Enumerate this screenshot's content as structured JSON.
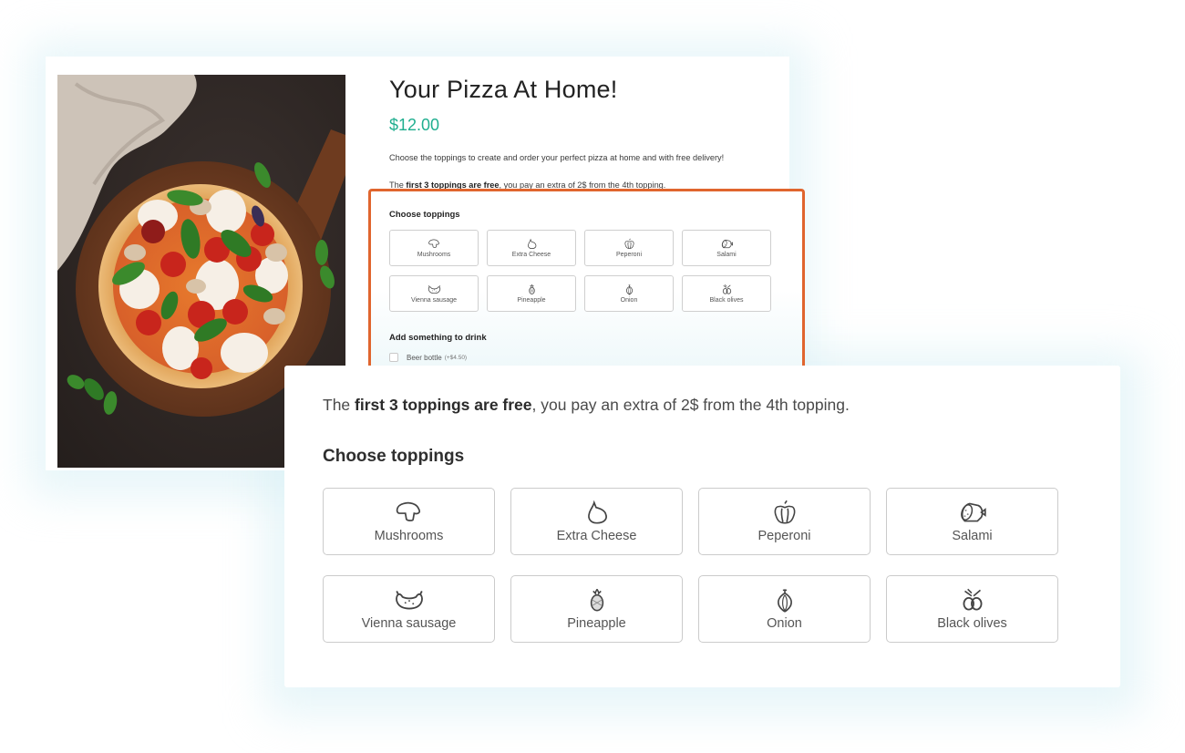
{
  "product": {
    "title": "Your Pizza At Home!",
    "price": "$12.00",
    "description": "Choose the toppings to create and order your perfect pizza at home and with free delivery!",
    "image_alt": "Margherita pizza with basil, cherry tomatoes, mozzarella and mushrooms on a wooden board"
  },
  "free_note": {
    "prefix": "The ",
    "bold": "first 3 toppings are free",
    "suffix": ", you pay an extra of 2$ from the 4th topping."
  },
  "toppings": {
    "label": "Choose toppings",
    "items": [
      {
        "label": "Mushrooms",
        "icon": "mushroom-icon"
      },
      {
        "label": "Extra Cheese",
        "icon": "cheese-icon"
      },
      {
        "label": "Peperoni",
        "icon": "pepper-icon"
      },
      {
        "label": "Salami",
        "icon": "salami-icon"
      },
      {
        "label": "Vienna sausage",
        "icon": "sausage-icon"
      },
      {
        "label": "Pineapple",
        "icon": "pineapple-icon"
      },
      {
        "label": "Onion",
        "icon": "onion-icon"
      },
      {
        "label": "Black olives",
        "icon": "olives-icon"
      }
    ]
  },
  "drinks": {
    "label": "Add something to drink",
    "items": [
      {
        "label": "Beer bottle",
        "price_extra": "(+$4.50)",
        "checked": false
      }
    ]
  },
  "colors": {
    "price": "#1fae8f",
    "highlight": "#e0652e",
    "tile_border": "#cbcbcb"
  }
}
